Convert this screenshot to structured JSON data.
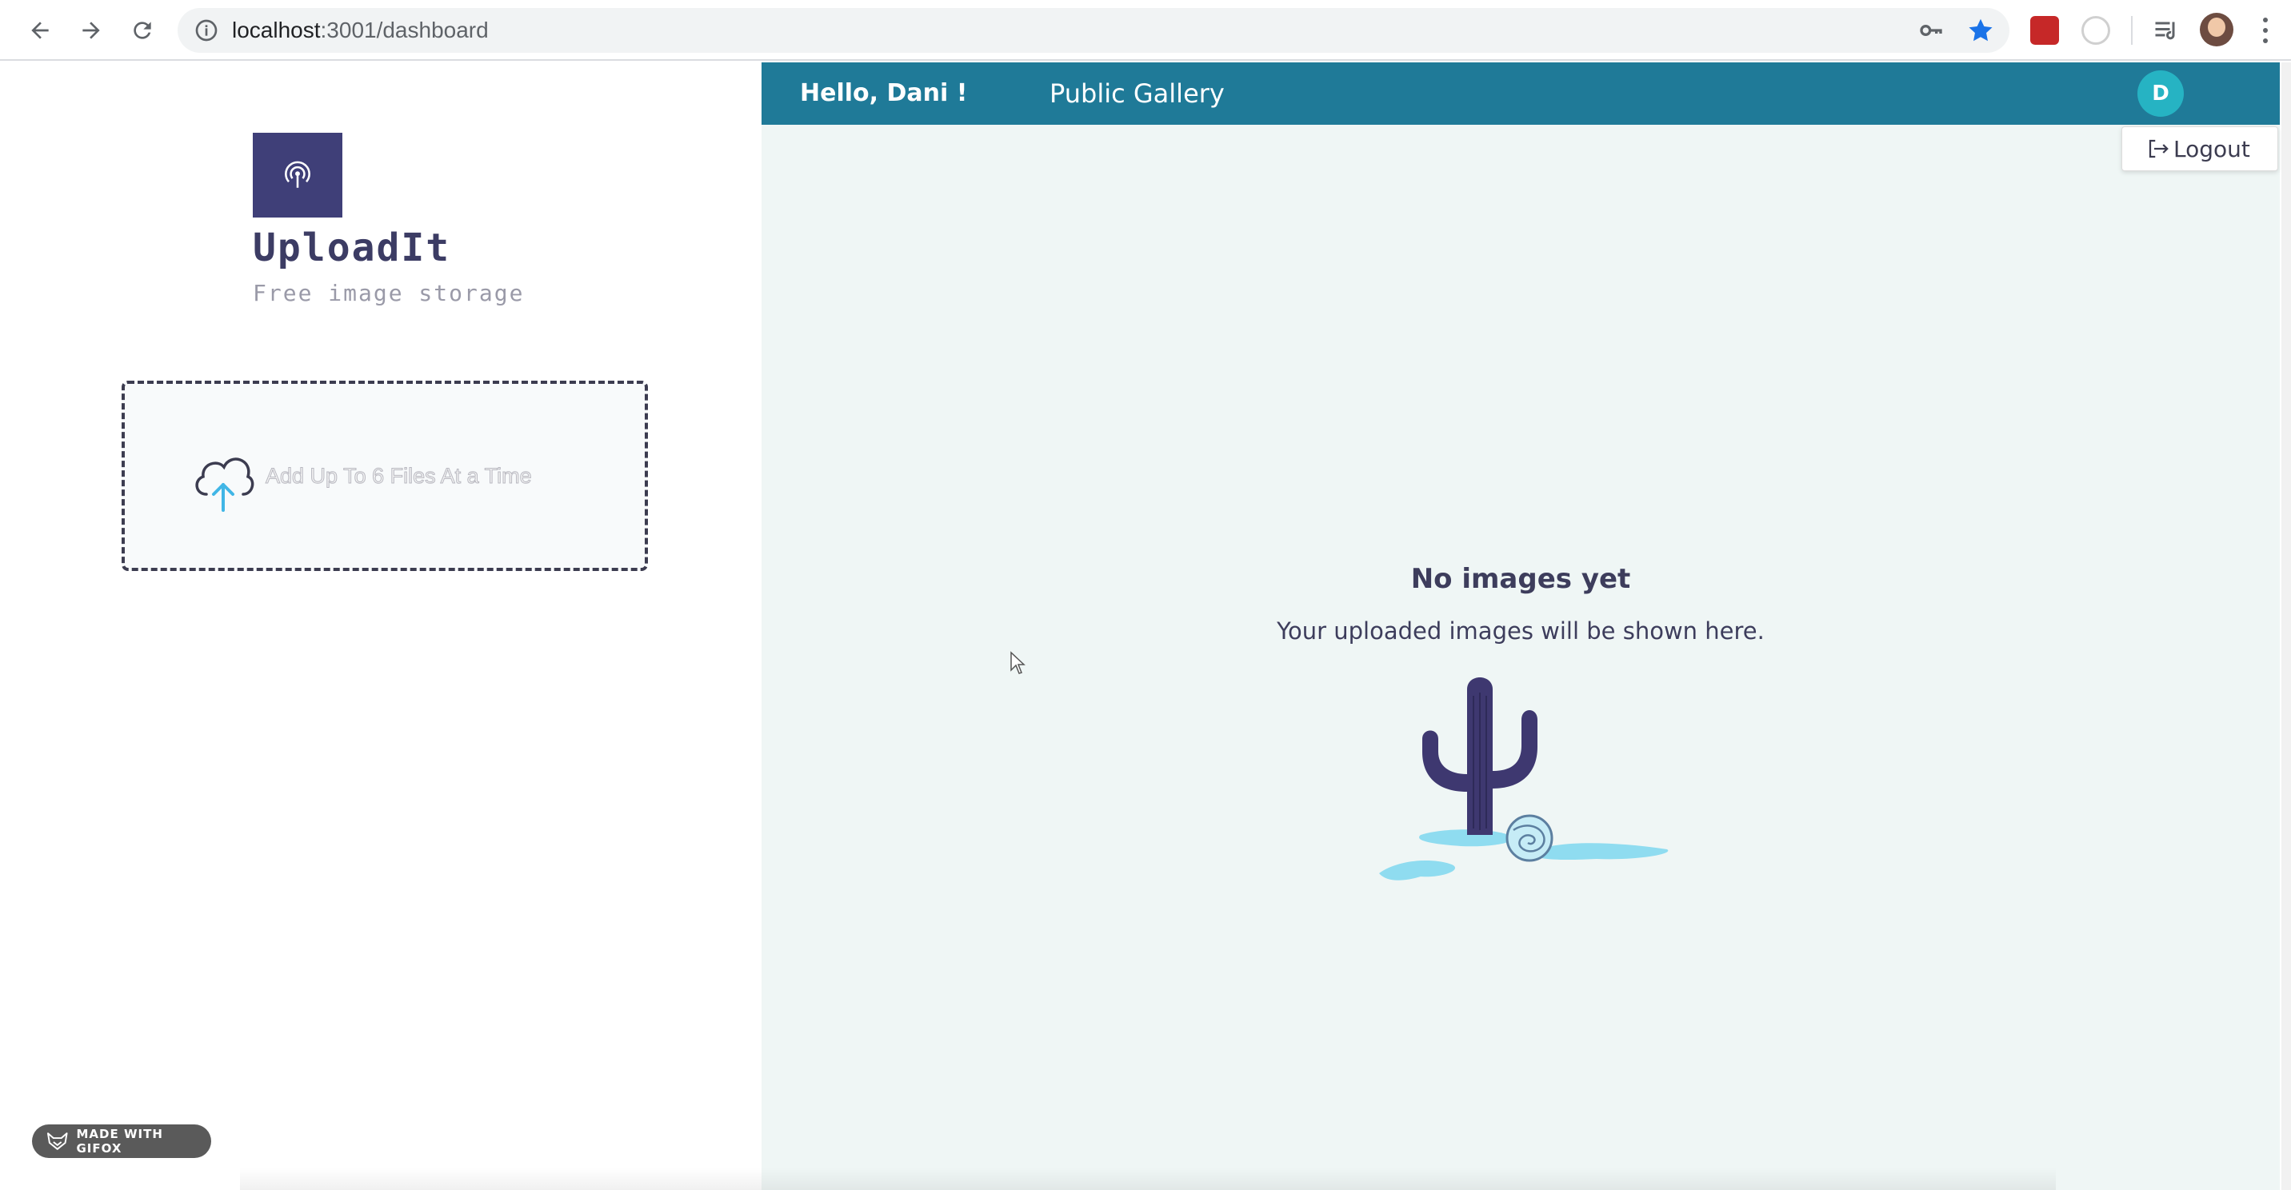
{
  "browser": {
    "url_host": "localhost",
    "url_path": ":3001/dashboard"
  },
  "sidebar": {
    "brand_name": "UploadIt",
    "brand_tagline": "Free image storage",
    "dropzone_text": "Add Up To 6 Files At a Time",
    "badge_text": "MADE WITH GIFOX"
  },
  "header": {
    "greeting": "Hello, Dani !",
    "nav_link": "Public Gallery",
    "avatar_initial": "D",
    "logout_label": "Logout"
  },
  "main": {
    "empty_title": "No images yet",
    "empty_subtitle": "Your uploaded images will be shown here."
  },
  "colors": {
    "topbar": "#1f7a98",
    "avatar": "#26b3c3",
    "logo": "#3f3f78",
    "panel_bg": "#eff6f5",
    "text_dark": "#3d3d5c",
    "cloud_arrow": "#41b6e6"
  },
  "icons": {
    "back": "arrow-left-icon",
    "forward": "arrow-right-icon",
    "reload": "reload-icon",
    "site_info": "info-icon",
    "password": "key-icon",
    "bookmark": "star-icon",
    "logo": "broadcast-icon",
    "upload": "cloud-upload-icon",
    "logout": "logout-icon"
  }
}
